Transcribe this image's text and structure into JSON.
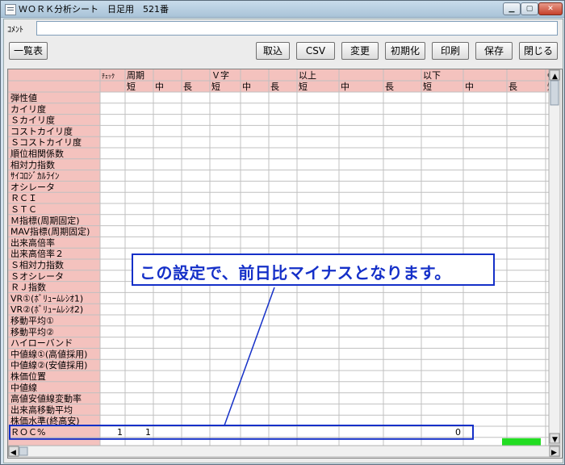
{
  "window": {
    "title": "ＷＯＲＫ分析シート　日足用　521番",
    "min_glyph": "▁",
    "max_glyph": "▢",
    "close_glyph": "✕"
  },
  "comment": {
    "label": "ｺﾒﾝﾄ",
    "value": ""
  },
  "toolbar": {
    "list_label": "一覧表",
    "import_label": "取込",
    "csv_label": "CSV",
    "change_label": "変更",
    "init_label": "初期化",
    "print_label": "印刷",
    "save_label": "保存",
    "close_label": "閉じる"
  },
  "grid": {
    "top_headers": [
      "ﾁｪｯｸ",
      "周期",
      "Ｖ字",
      "以上",
      "以下",
      "G"
    ],
    "sub_headers": [
      "短",
      "中",
      "長",
      "短",
      "中",
      "長",
      "短",
      "中",
      "長",
      "短",
      "中",
      "長",
      "短"
    ],
    "rows": [
      "弾性値",
      "カイリ度",
      "Ｓカイリ度",
      "コストカイリ度",
      "Ｓコストカイリ度",
      "順位相関係数",
      "相対力指数",
      "ｻｲｺﾛｼﾞｶﾙﾗｲﾝ",
      "オシレータ",
      "ＲＣＩ",
      "ＳＴＣ",
      "Ｍ指標(周期固定)",
      "MAV指標(周期固定)",
      "出来高倍率",
      "出来高倍率２",
      "Ｓ相対力指数",
      "Ｓオシレータ",
      "ＲＪ指数",
      "VR①(ﾎﾞﾘｭｰﾑﾚｼｵ1)",
      "VR②(ﾎﾞﾘｭｰﾑﾚｼｵ2)",
      "移動平均①",
      "移動平均②",
      "ハイローバンド",
      "中値線①(高値採用)",
      "中値線②(安値採用)",
      "株価位置",
      "中値線",
      "高値安値線変動率",
      "出来高移動平均",
      "株価水準(終高安)",
      "ＲＯＣ%"
    ],
    "roc_values": {
      "check": "1",
      "period_short": "1",
      "above_short": "0"
    },
    "status_color": "#22dd22"
  },
  "callout": {
    "text": "この設定で、前日比マイナスとなります。",
    "color": "#1530c8"
  },
  "colors": {
    "header_fill": "#f4c2be",
    "grid_line": "#c0c0c0",
    "window_bg": "#d4e2ee"
  }
}
